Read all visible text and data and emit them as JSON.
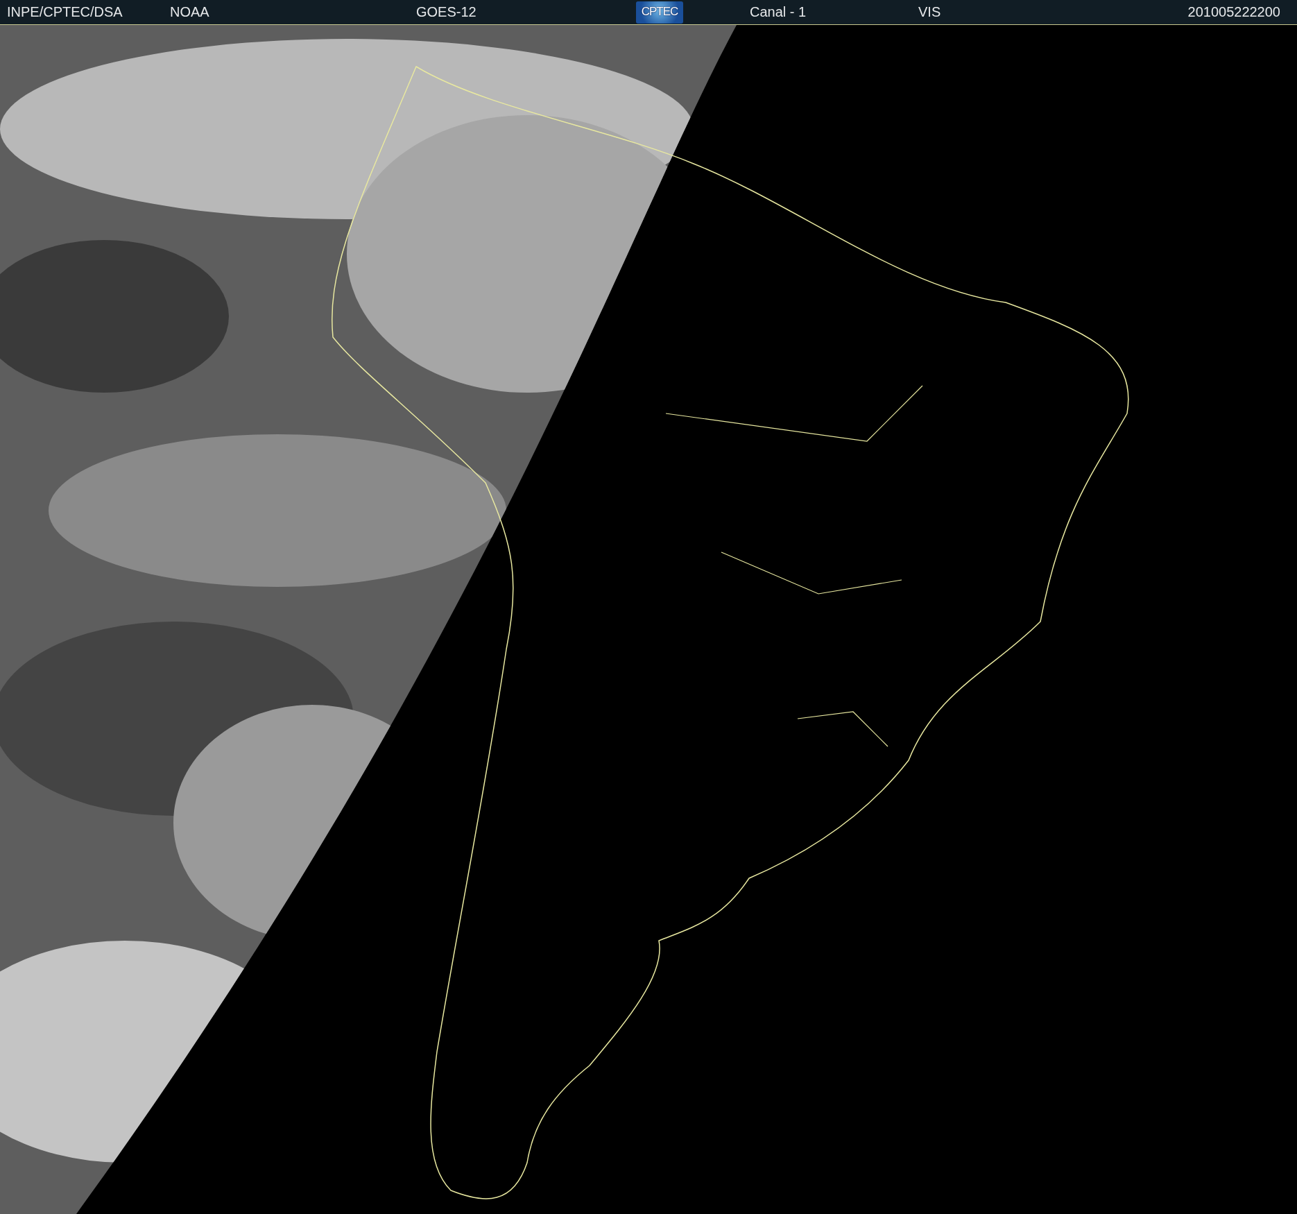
{
  "header": {
    "agency": "INPE/CPTEC/DSA",
    "source": "NOAA",
    "satellite": "GOES-12",
    "logo": "CPTEC",
    "channel": "Canal - 1",
    "band": "VIS",
    "timestamp": "201005222200"
  }
}
